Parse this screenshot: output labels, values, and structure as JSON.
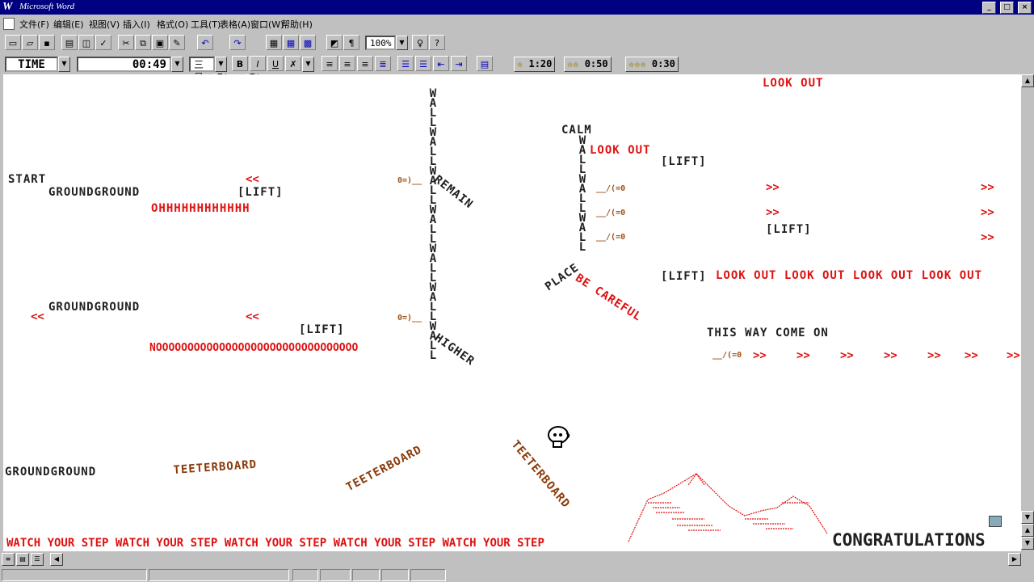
{
  "window": {
    "title": "Microsoft Word",
    "icon": "word-logo",
    "controls": [
      "_",
      "□",
      "×"
    ]
  },
  "menu": [
    "文件(F)",
    "编辑(E)",
    "视图(V)",
    "插入(I)",
    "格式(O)",
    "工具(T)",
    "表格(A)",
    "窗口(W)",
    "帮助(H)"
  ],
  "toolbar": {
    "zoom": "100%"
  },
  "format_bar": {
    "style_label": "TIME",
    "timer": "00:49",
    "size": "三号",
    "bold": "B",
    "italic": "I",
    "underline": "U"
  },
  "stars": [
    {
      "stars": "☆",
      "time": "1:20"
    },
    {
      "stars": "☆☆",
      "time": "0:50"
    },
    {
      "stars": "☆☆☆",
      "time": "0:30"
    }
  ],
  "level": {
    "start": "START",
    "ground1": "GROUNDGROUND",
    "ground2": "GROUNDGROUND",
    "ground3": "GROUNDGROUND",
    "ohh": "OHHHHHHHHHHHH",
    "nooo": "NOOOOOOOOOOOOOOOOOOOOOOOOOOOOOOOO",
    "lift": "[LIFT]",
    "remain": "REMAIN",
    "higher": "HIGHER",
    "calm": "CALM",
    "place": "PLACE",
    "be_careful": "BE CAREFUL",
    "look_out": "LOOK OUT",
    "look_out_row": "LOOK OUT LOOK OUT LOOK OUT LOOK OUT",
    "this_way": "THIS WAY COME ON",
    "teeter": "TEETERBOARD",
    "watch": "WATCH YOUR STEP WATCH YOUR STEP WATCH YOUR STEP WATCH YOUR STEP WATCH YOUR STEP",
    "congrats": "CONGRATULATIONS",
    "wall_left": "WALLWALLWALLWALLWALLWALLWALL",
    "wall_right": "WALLWALLWALL",
    "arrow_left": "<<",
    "arrow_right": ">>",
    "cannon_right": "__/(=0",
    "cannon_left": "0=)__"
  }
}
